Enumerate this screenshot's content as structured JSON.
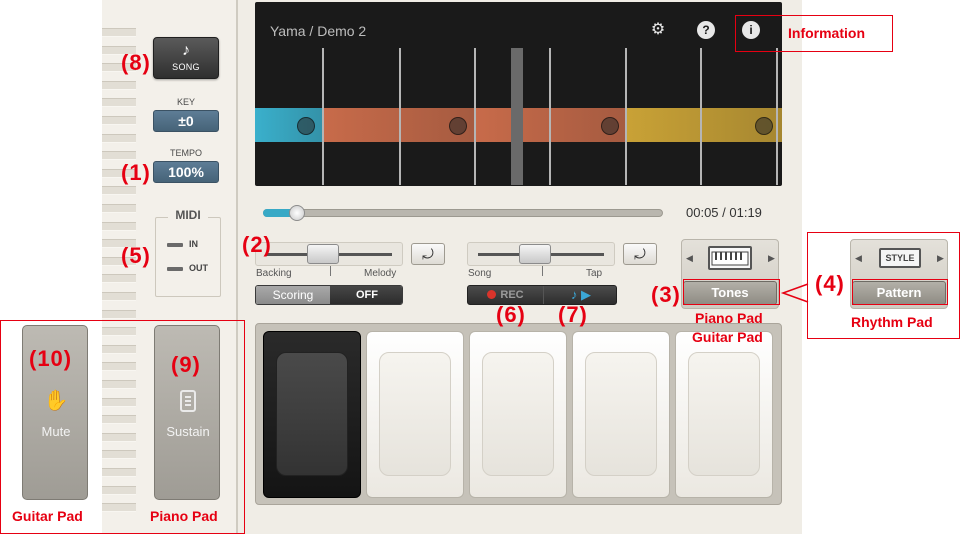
{
  "song_button": {
    "label": "SONG",
    "icon": "music-note-icon"
  },
  "key": {
    "label": "KEY",
    "value": "±0"
  },
  "tempo": {
    "label": "TEMPO",
    "value": "100%"
  },
  "midi": {
    "title": "MIDI",
    "in_label": "IN",
    "out_label": "OUT"
  },
  "display": {
    "song_title": "Yama / Demo 2",
    "icons": [
      "gear-icon",
      "help-icon",
      "info-icon"
    ],
    "bar_colors": [
      "#3ab0cc",
      "#c86b4a",
      "#c9a236"
    ],
    "progress_fraction": 0.085
  },
  "progress": {
    "time": "00:05 / 01:19"
  },
  "balance": {
    "left_label": "Backing",
    "right_label": "Melody"
  },
  "guide": {
    "left_label": "Song",
    "right_label": "Tap"
  },
  "scoring": {
    "label": "Scoring",
    "state": "OFF"
  },
  "record": {
    "rec_label": "REC"
  },
  "tones": {
    "label": "Tones"
  },
  "pattern": {
    "label": "Pattern",
    "icon_text": "STYLE"
  },
  "side_pads": {
    "mute": {
      "label": "Mute"
    },
    "sustain": {
      "label": "Sustain"
    }
  },
  "annotations": {
    "n1": "(1)",
    "n2": "(2)",
    "n3": "(3)",
    "n4": "(4)",
    "n5": "(5)",
    "n6": "(6)",
    "n7": "(7)",
    "n8": "(8)",
    "n9": "(9)",
    "n10": "(10)",
    "information": "Information",
    "piano_pad_1": "Piano Pad",
    "guitar_pad_1": "Guitar Pad",
    "rhythm_pad": "Rhythm Pad",
    "guitar_pad_2": "Guitar Pad",
    "piano_pad_2": "Piano Pad"
  }
}
